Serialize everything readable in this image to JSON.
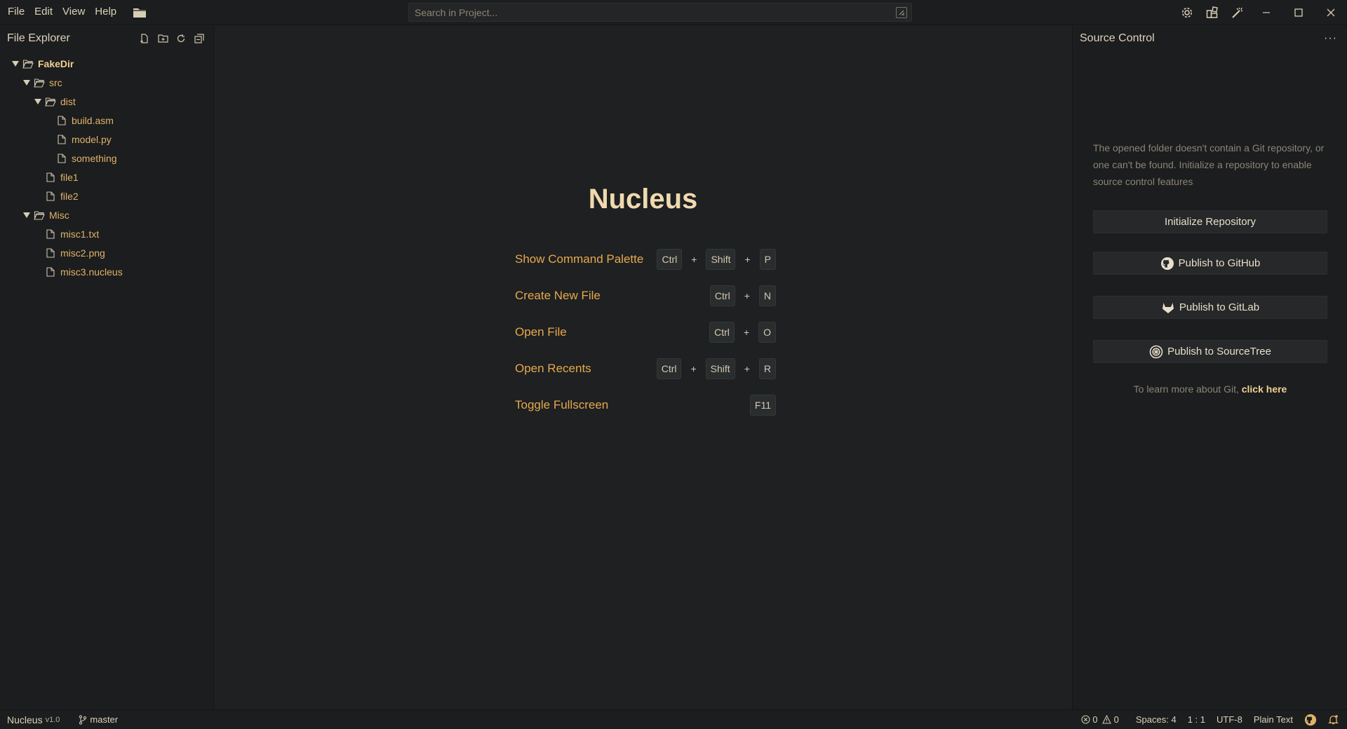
{
  "menu": {
    "items": [
      "File",
      "Edit",
      "View",
      "Help"
    ]
  },
  "search": {
    "placeholder": "Search in Project..."
  },
  "file_explorer": {
    "title": "File Explorer",
    "tree": [
      {
        "label": "FakeDir",
        "type": "folder",
        "depth": 0,
        "expanded": true
      },
      {
        "label": "src",
        "type": "folder",
        "depth": 1,
        "expanded": true
      },
      {
        "label": "dist",
        "type": "folder",
        "depth": 2,
        "expanded": true
      },
      {
        "label": "build.asm",
        "type": "file",
        "depth": 3
      },
      {
        "label": "model.py",
        "type": "file",
        "depth": 3
      },
      {
        "label": "something",
        "type": "file",
        "depth": 3
      },
      {
        "label": "file1",
        "type": "file",
        "depth": 2
      },
      {
        "label": "file2",
        "type": "file",
        "depth": 2
      },
      {
        "label": "Misc",
        "type": "folder",
        "depth": 1,
        "expanded": true
      },
      {
        "label": "misc1.txt",
        "type": "file",
        "depth": 2
      },
      {
        "label": "misc2.png",
        "type": "file",
        "depth": 2
      },
      {
        "label": "misc3.nucleus",
        "type": "file",
        "depth": 2
      }
    ]
  },
  "welcome": {
    "title": "Nucleus",
    "shortcuts": [
      {
        "label": "Show Command Palette",
        "keys": [
          "Ctrl",
          "Shift",
          "P"
        ]
      },
      {
        "label": "Create New File",
        "keys": [
          "Ctrl",
          "N"
        ]
      },
      {
        "label": "Open File",
        "keys": [
          "Ctrl",
          "O"
        ]
      },
      {
        "label": "Open Recents",
        "keys": [
          "Ctrl",
          "Shift",
          "R"
        ]
      },
      {
        "label": "Toggle Fullscreen",
        "keys": [
          "F11"
        ]
      }
    ],
    "key_separator": "+"
  },
  "source_control": {
    "title": "Source Control",
    "more_label": "···",
    "message": "The opened folder doesn't contain a Git repository, or one can't be found. Initialize a repository to enable source control features",
    "buttons": {
      "init": "Initialize Repository",
      "github": "Publish to GitHub",
      "gitlab": "Publish to GitLab",
      "sourcetree": "Publish to SourceTree"
    },
    "learn_prefix": "To learn more about Git, ",
    "learn_link": "click here"
  },
  "statusbar": {
    "app_name": "Nucleus",
    "version": "v1.0",
    "branch": "master",
    "errors": "0",
    "warnings": "0",
    "spaces": "Spaces: 4",
    "position": "1 : 1",
    "encoding": "UTF-8",
    "language": "Plain Text"
  },
  "colors": {
    "background": "#1e2021",
    "panel": "#1b1d1e",
    "accent": "#e6a94d",
    "title": "#f0d9b0"
  },
  "icons": {
    "open_folder": "folder-icon",
    "settings": "gear-icon",
    "layout": "layout-icon",
    "tools": "wand-icon",
    "github": "github-icon",
    "gitlab": "gitlab-icon",
    "sourcetree": "sourcetree-icon"
  }
}
